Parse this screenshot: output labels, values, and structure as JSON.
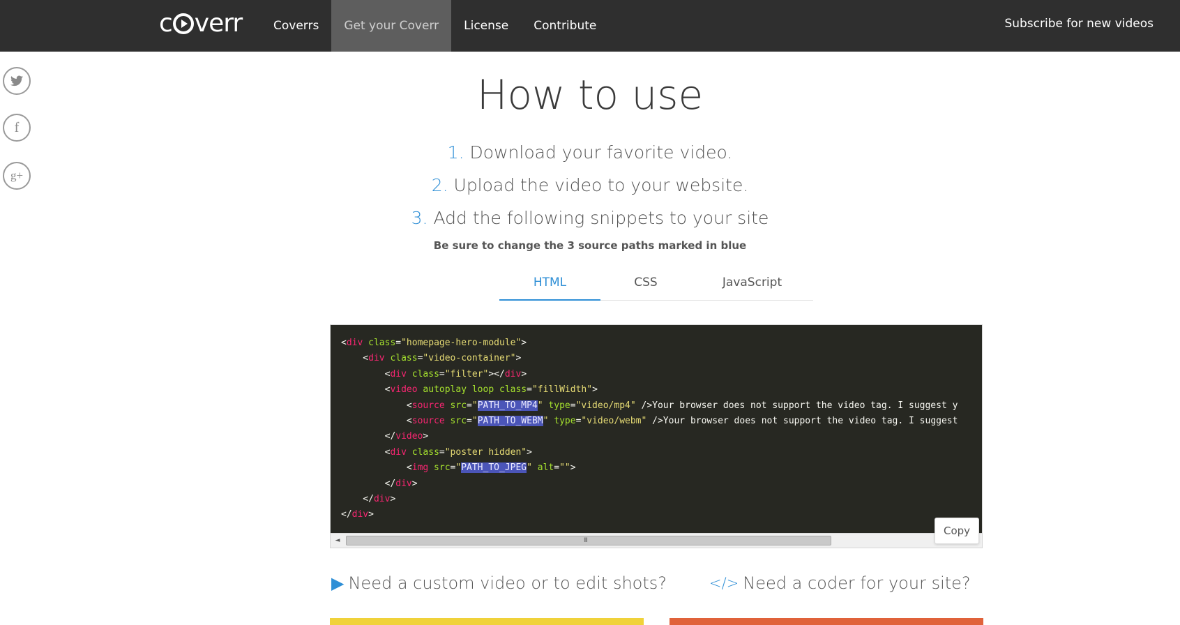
{
  "header": {
    "logo": {
      "before": "c",
      "after": "verr"
    },
    "nav": [
      {
        "label": "Coverrs",
        "active": false
      },
      {
        "label": "Get your Coverr",
        "active": true
      },
      {
        "label": "License",
        "active": false
      },
      {
        "label": "Contribute",
        "active": false
      }
    ],
    "subscribe": "Subscribe for new videos"
  },
  "social": [
    {
      "icon": "twitter-icon"
    },
    {
      "icon": "facebook-icon",
      "glyph": "f"
    },
    {
      "icon": "google-plus-icon",
      "glyph": "g+"
    }
  ],
  "main": {
    "title": "How to use",
    "steps": [
      {
        "num": "1.",
        "text": "Download your favorite video."
      },
      {
        "num": "2.",
        "text": "Upload the video to your website."
      },
      {
        "num": "3.",
        "text": "Add the following snippets to your site"
      }
    ],
    "note": "Be sure to change the 3 source paths marked in blue",
    "tabs": [
      {
        "label": "HTML",
        "active": true
      },
      {
        "label": "CSS",
        "active": false
      },
      {
        "label": "JavaScript",
        "active": false
      }
    ],
    "code_lines": [
      [
        [
          "t-txt",
          "<"
        ],
        [
          "t-tag",
          "div"
        ],
        [
          "t-attr",
          " class"
        ],
        [
          "t-txt",
          "="
        ],
        [
          "t-str",
          "\"homepage-hero-module\""
        ],
        [
          "t-txt",
          ">"
        ]
      ],
      [
        [
          "t-txt",
          "    <"
        ],
        [
          "t-tag",
          "div"
        ],
        [
          "t-attr",
          " class"
        ],
        [
          "t-txt",
          "="
        ],
        [
          "t-str",
          "\"video-container\""
        ],
        [
          "t-txt",
          ">"
        ]
      ],
      [
        [
          "t-txt",
          "        <"
        ],
        [
          "t-tag",
          "div"
        ],
        [
          "t-attr",
          " class"
        ],
        [
          "t-txt",
          "="
        ],
        [
          "t-str",
          "\"filter\""
        ],
        [
          "t-txt",
          "></"
        ],
        [
          "t-tag",
          "div"
        ],
        [
          "t-txt",
          ">"
        ]
      ],
      [
        [
          "t-txt",
          "        <"
        ],
        [
          "t-tag",
          "video"
        ],
        [
          "t-attr",
          " autoplay loop class"
        ],
        [
          "t-txt",
          "="
        ],
        [
          "t-str",
          "\"fillWidth\""
        ],
        [
          "t-txt",
          ">"
        ]
      ],
      [
        [
          "t-txt",
          "            <"
        ],
        [
          "t-tag",
          "source"
        ],
        [
          "t-attr",
          " src"
        ],
        [
          "t-txt",
          "="
        ],
        [
          "t-str",
          "\""
        ],
        [
          "t-hl",
          "PATH_TO_MP4"
        ],
        [
          "t-str",
          "\""
        ],
        [
          "t-attr",
          " type"
        ],
        [
          "t-txt",
          "="
        ],
        [
          "t-str",
          "\"video/mp4\""
        ],
        [
          "t-txt",
          " />Your browser does not support the video tag. I suggest y"
        ]
      ],
      [
        [
          "t-txt",
          "            <"
        ],
        [
          "t-tag",
          "source"
        ],
        [
          "t-attr",
          " src"
        ],
        [
          "t-txt",
          "="
        ],
        [
          "t-str",
          "\""
        ],
        [
          "t-hl",
          "PATH_TO_WEBM"
        ],
        [
          "t-str",
          "\""
        ],
        [
          "t-attr",
          " type"
        ],
        [
          "t-txt",
          "="
        ],
        [
          "t-str",
          "\"video/webm\""
        ],
        [
          "t-txt",
          " />Your browser does not support the video tag. I suggest"
        ]
      ],
      [
        [
          "t-txt",
          "        </"
        ],
        [
          "t-tag",
          "video"
        ],
        [
          "t-txt",
          ">"
        ]
      ],
      [
        [
          "t-txt",
          "        <"
        ],
        [
          "t-tag",
          "div"
        ],
        [
          "t-attr",
          " class"
        ],
        [
          "t-txt",
          "="
        ],
        [
          "t-str",
          "\"poster hidden\""
        ],
        [
          "t-txt",
          ">"
        ]
      ],
      [
        [
          "t-txt",
          "            <"
        ],
        [
          "t-tag",
          "img"
        ],
        [
          "t-attr",
          " src"
        ],
        [
          "t-txt",
          "="
        ],
        [
          "t-str",
          "\""
        ],
        [
          "t-hl",
          "PATH_TO_JPEG"
        ],
        [
          "t-str",
          "\""
        ],
        [
          "t-attr",
          " alt"
        ],
        [
          "t-txt",
          "="
        ],
        [
          "t-str",
          "\"\""
        ],
        [
          "t-txt",
          ">"
        ]
      ],
      [
        [
          "t-txt",
          "        </"
        ],
        [
          "t-tag",
          "div"
        ],
        [
          "t-txt",
          ">"
        ]
      ],
      [
        [
          "t-txt",
          "    </"
        ],
        [
          "t-tag",
          "div"
        ],
        [
          "t-txt",
          ">"
        ]
      ],
      [
        [
          "t-txt",
          "</"
        ],
        [
          "t-tag",
          "div"
        ],
        [
          "t-txt",
          ">"
        ]
      ]
    ],
    "copy_label": "Copy",
    "scroll_left": "◄",
    "scroll_grip": "III"
  },
  "bottom": {
    "custom_video": {
      "icon": "play-icon",
      "glyph": "▶",
      "text": "Need a custom video or to edit shots?"
    },
    "coder": {
      "icon": "code-icon",
      "glyph": "</>",
      "text": "Need a coder for your site?"
    }
  },
  "colors": {
    "accent": "#2f8fd6",
    "yellow_bar": "#f0d23a",
    "orange_bar": "#e0623a"
  }
}
